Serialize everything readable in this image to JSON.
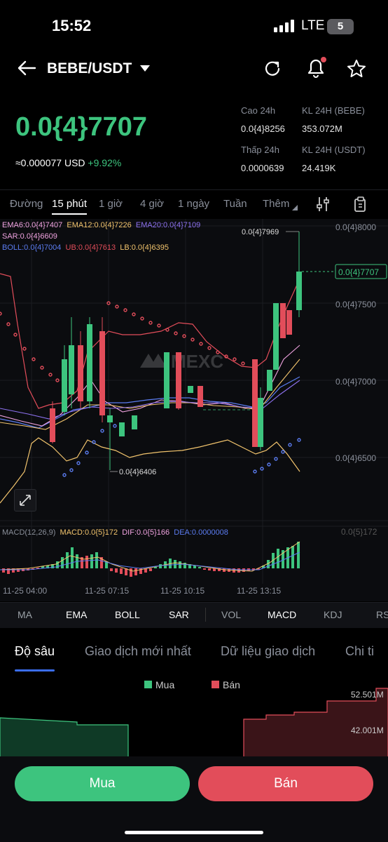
{
  "status_bar": {
    "time": "15:52",
    "network": "LTE",
    "battery": "5"
  },
  "header": {
    "pair": "BEBE/USDT"
  },
  "ticker": {
    "price": "0.0{4}7707",
    "approx": "≈0.000077 USD",
    "change": "+9.92%",
    "high_label": "Cao 24h",
    "high_value": "0.0{4}8256",
    "vol_bebe_label": "KL 24H (BEBE)",
    "vol_bebe_value": "353.072M",
    "low_label": "Thấp 24h",
    "low_value": "0.0000639",
    "vol_usdt_label": "KL 24H  (USDT)",
    "vol_usdt_value": "24.419K"
  },
  "timeframes": {
    "items": [
      "Đường",
      "15 phút",
      "1 giờ",
      "4 giờ",
      "1 ngày",
      "Tuần",
      "Thêm"
    ],
    "active": "15 phút"
  },
  "indicators": {
    "ema6": "EMA6:0.0{4}7407",
    "ema12": "EMA12:0.0{4}7226",
    "ema20": "EMA20:0.0{4}7109",
    "sar": "SAR:0.0{4}6609",
    "boll": "BOLL:0.0{4}7004",
    "ub": "UB:0.0{4}7613",
    "lb": "LB:0.0{4}6395",
    "macd_params": "MACD(12,26,9)",
    "macd": "MACD:0.0{5}172",
    "dif": "DIF:0.0{5}166",
    "dea": "DEA:0.0000008"
  },
  "chart": {
    "y_labels": [
      "0.0{4}8000",
      "0.0{4}7500",
      "0.0{4}7000",
      "0.0{4}6500"
    ],
    "current_price_tag": "0.0{4}7707",
    "high_marker": "0.0{4}7969",
    "low_marker": "0.0{4}6406",
    "macd_axis_label": "0.0{5}172",
    "x_labels": [
      "11-25 04:00",
      "11-25 07:15",
      "11-25 10:15",
      "11-25 13:15"
    ],
    "watermark": "MEXC",
    "colors": {
      "up": "#3dc47e",
      "down": "#e24d5a"
    }
  },
  "indicator_bar": [
    "MA",
    "EMA",
    "BOLL",
    "SAR",
    "VOL",
    "MACD",
    "KDJ",
    "RS"
  ],
  "depth_tabs": [
    "Độ sâu",
    "Giao dịch mới nhất",
    "Dữ liệu giao dịch",
    "Chi ti"
  ],
  "depth": {
    "buy_legend": "Mua",
    "sell_legend": "Bán",
    "level1": "52.501M",
    "level2": "42.001M"
  },
  "actions": {
    "buy": "Mua",
    "sell": "Bán",
    "buy_color": "#3dc47e",
    "sell_color": "#e24d5a"
  }
}
